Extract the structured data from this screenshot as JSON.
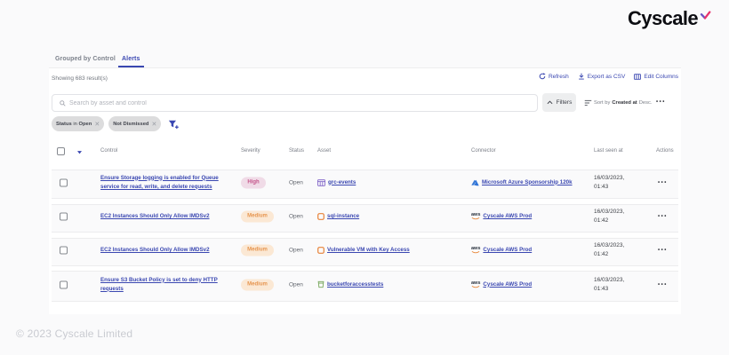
{
  "brand": {
    "logo_text": "Cyscale"
  },
  "tabs": {
    "grouped": "Grouped by Control",
    "alerts": "Alerts"
  },
  "toolbar": {
    "results": "Showing 683 result(s)",
    "refresh": "Refresh",
    "export_csv": "Export as CSV",
    "edit_columns": "Edit Columns"
  },
  "search": {
    "placeholder": "Search by asset and control"
  },
  "controls": {
    "filters": "Filters",
    "sort_by": "Sort by",
    "sort_field": "Created at",
    "sort_dir": "Desc.",
    "more": "•••"
  },
  "chips": {
    "chip1_field": "Status",
    "chip1_op": "in",
    "chip1_value": "Open",
    "chip2_label": "Not Dismissed",
    "close": "✕"
  },
  "table": {
    "headers": {
      "control": "Control",
      "severity": "Severity",
      "status": "Status",
      "asset": "Asset",
      "connector": "Connector",
      "last_seen": "Last seen at",
      "actions": "Actions"
    },
    "actions_dots": "•••",
    "rows": [
      {
        "control": "Ensure Storage logging is enabled for Queue service for read, write, and delete requests",
        "severity": "High",
        "status": "Open",
        "asset": "grc-events",
        "connector": "Microsoft Azure Sponsorship 120k",
        "date": "16/03/2023,",
        "time": "01:43"
      },
      {
        "control": "EC2 Instances Should Only Allow IMDSv2",
        "severity": "Medium",
        "status": "Open",
        "asset": "sql-instance",
        "connector": "Cyscale AWS Prod",
        "date": "16/03/2023,",
        "time": "01:42"
      },
      {
        "control": "EC2 Instances Should Only Allow IMDSv2",
        "severity": "Medium",
        "status": "Open",
        "asset": "Vulnerable VM with Key Access",
        "connector": "Cyscale AWS Prod",
        "date": "16/03/2023,",
        "time": "01:42"
      },
      {
        "control": "Ensure S3 Bucket Policy is set to deny HTTP requests",
        "severity": "Medium",
        "status": "Open",
        "asset": "bucketforaccesstests",
        "connector": "Cyscale AWS Prod",
        "date": "16/03/2023,",
        "time": "01:43"
      }
    ]
  },
  "icons": {
    "aws_word": "aws"
  },
  "footer": {
    "copyright": "© 2023 Cyscale Limited"
  }
}
